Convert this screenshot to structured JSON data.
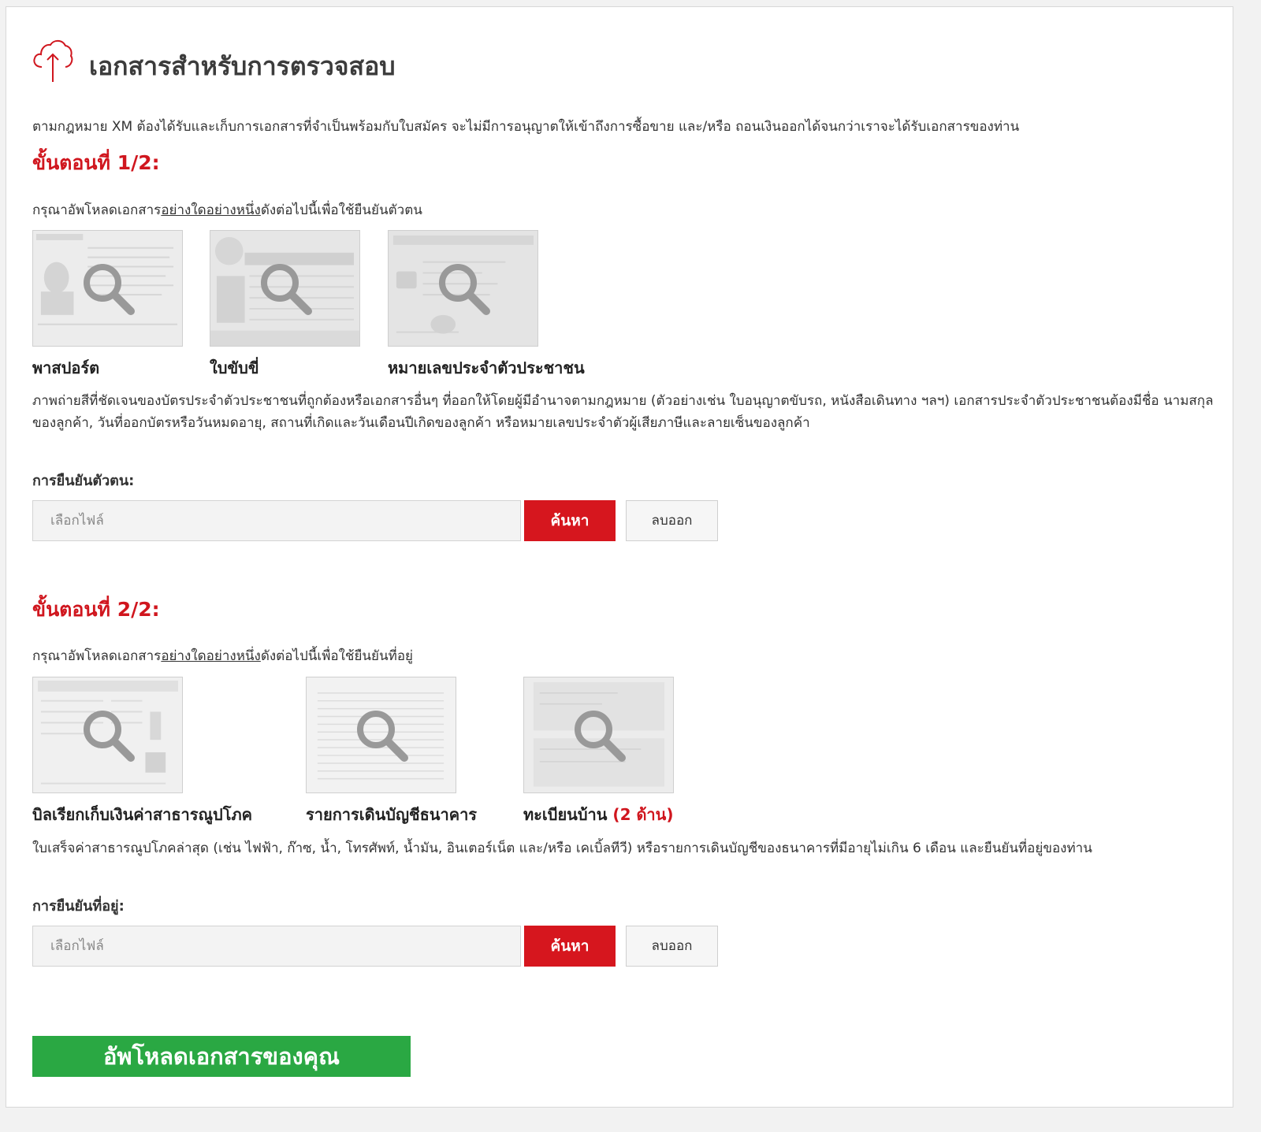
{
  "header": {
    "icon": "cloud-upload-icon",
    "title": "เอกสารสำหรับการตรวจสอบ"
  },
  "intro": "ตามกฎหมาย XM ต้องได้รับและเก็บการเอกสารที่จำเป็นพร้อมกับใบสมัคร จะไม่มีการอนุญาตให้เข้าถึงการซื้อขาย และ/หรือ ถอนเงินออกได้จนกว่าเราจะได้รับเอกสารของท่าน",
  "colors": {
    "accent": "#d0161e",
    "upload": "#2aa843"
  },
  "step1": {
    "title": "ขั้นตอนที่ 1/2:",
    "instruction_before": "กรุณาอัพโหลดเอกสาร",
    "instruction_underlined": "อย่างใดอย่างหนึ่ง",
    "instruction_after": "ดังต่อไปนี้เพื่อใช้ยืนยันตัวตน",
    "documents": [
      {
        "label": "พาสปอร์ต",
        "icon": "magnifier-icon"
      },
      {
        "label": "ใบขับขี่",
        "icon": "magnifier-icon"
      },
      {
        "label": "หมายเลขประจำตัวประชาชน",
        "icon": "magnifier-icon"
      }
    ],
    "description": "ภาพถ่ายสีที่ชัดเจนของบัตรประจำตัวประชาชนที่ถูกต้องหรือเอกสารอื่นๆ ที่ออกให้โดยผู้มีอำนาจตามกฎหมาย (ตัวอย่างเช่น ใบอนุญาตขับรถ, หนังสือเดินทาง ฯลฯ) เอกสารประจำตัวประชาชนต้องมีชื่อ นามสกุลของลูกค้า, วันที่ออกบัตรหรือวันหมดอายุ, สถานที่เกิดและวันเดือนปีเกิดของลูกค้า หรือหมายเลขประจำตัวผู้เสียภาษีและลายเซ็นของลูกค้า",
    "field_label": "การยืนยันตัวตน:",
    "file_placeholder": "เลือกไฟล์",
    "browse_label": "ค้นหา",
    "remove_label": "ลบออก"
  },
  "step2": {
    "title": "ขั้นตอนที่ 2/2:",
    "instruction_before": "กรุณาอัพโหลดเอกสาร",
    "instruction_underlined": "อย่างใดอย่างหนึ่ง",
    "instruction_after": "ดังต่อไปนี้เพื่อใช้ยืนยันที่อยู่",
    "documents": [
      {
        "label": "บิลเรียกเก็บเงินค่าสาธารณูปโภค",
        "note": "",
        "icon": "magnifier-icon"
      },
      {
        "label": "รายการเดินบัญชีธนาคาร",
        "note": "",
        "icon": "magnifier-icon"
      },
      {
        "label": "ทะเบียนบ้าน ",
        "note": "(2 ด้าน)",
        "icon": "magnifier-icon"
      }
    ],
    "description": "ใบเสร็จค่าสาธารณูปโภคล่าสุด (เช่น ไฟฟ้า, ก๊าซ, น้ำ, โทรศัพท์, น้ำมัน, อินเตอร์เน็ต และ/หรือ เคเบิ้ลทีวี) หรือรายการเดินบัญชีของธนาคารที่มีอายุไม่เกิน 6 เดือน และยืนยันที่อยู่ของท่าน",
    "field_label": "การยืนยันที่อยู่:",
    "file_placeholder": "เลือกไฟล์",
    "browse_label": "ค้นหา",
    "remove_label": "ลบออก"
  },
  "upload_button": "อัพโหลดเอกสารของคุณ"
}
